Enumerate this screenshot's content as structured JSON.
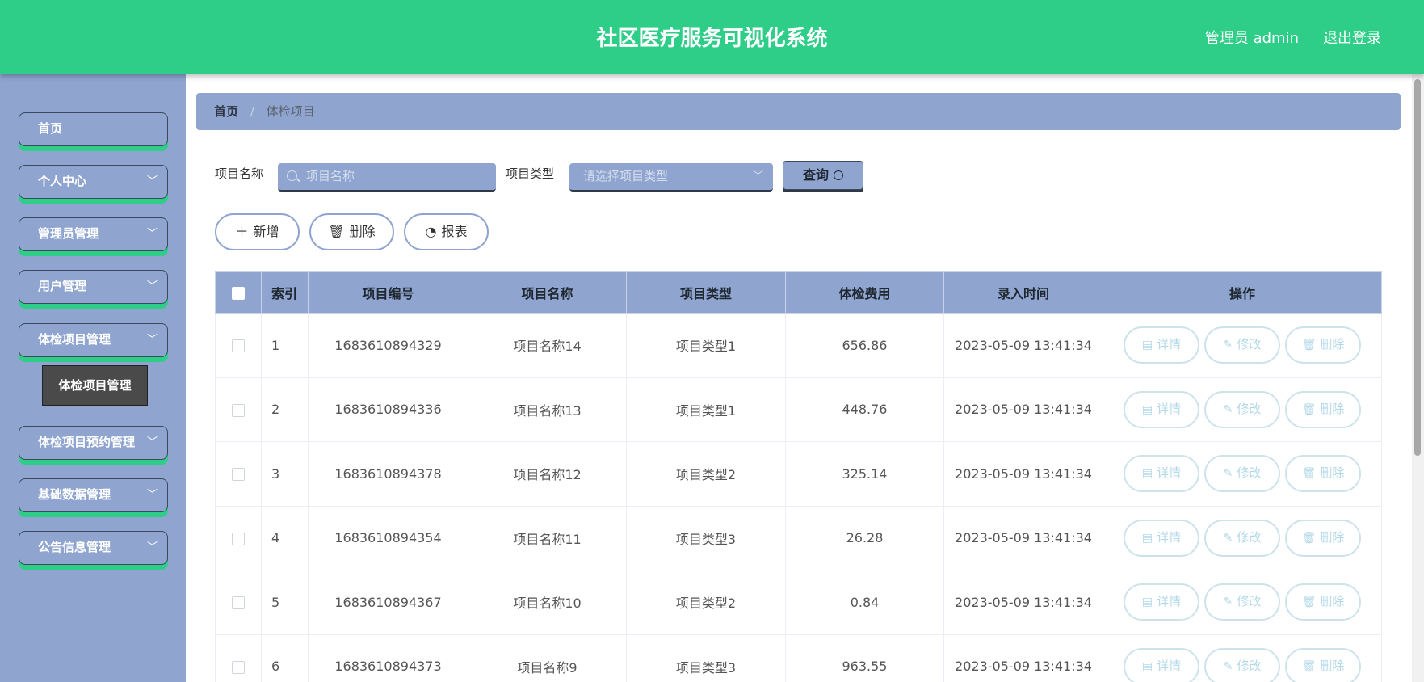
{
  "header": {
    "title": "社区医疗服务可视化系统",
    "admin_label": "管理员 admin",
    "logout_label": "退出登录"
  },
  "colors": {
    "header_bg": "#2ecd88",
    "sidebar_bg": "#8fa5d0",
    "accent_shadow": "#2ecd88",
    "op_button_border": "#cde3ec"
  },
  "sidebar": {
    "items": [
      {
        "label": "首页",
        "has_chevron": false
      },
      {
        "label": "个人中心",
        "has_chevron": true
      },
      {
        "label": "管理员管理",
        "has_chevron": true
      },
      {
        "label": "用户管理",
        "has_chevron": true
      },
      {
        "label": "体检项目管理",
        "has_chevron": true,
        "expanded": true
      },
      {
        "label": "体检项目预约管理",
        "has_chevron": true
      },
      {
        "label": "基础数据管理",
        "has_chevron": true
      },
      {
        "label": "公告信息管理",
        "has_chevron": true
      }
    ],
    "submenu": {
      "label": "体检项目管理"
    }
  },
  "breadcrumb": {
    "home": "首页",
    "separator": "/",
    "current": "体检项目"
  },
  "search": {
    "name_label": "项目名称",
    "name_placeholder": "项目名称",
    "type_label": "项目类型",
    "type_placeholder": "请选择项目类型",
    "query_label": "查询"
  },
  "actions": {
    "add_label": "新增",
    "delete_label": "删除",
    "report_label": "报表"
  },
  "table": {
    "columns": [
      "索引",
      "项目编号",
      "项目名称",
      "项目类型",
      "体检费用",
      "录入时间",
      "操作"
    ],
    "rows": [
      {
        "index": "1",
        "code": "1683610894329",
        "name": "项目名称14",
        "type": "项目类型1",
        "fee": "656.86",
        "time": "2023-05-09 13:41:34"
      },
      {
        "index": "2",
        "code": "1683610894336",
        "name": "项目名称13",
        "type": "项目类型1",
        "fee": "448.76",
        "time": "2023-05-09 13:41:34"
      },
      {
        "index": "3",
        "code": "1683610894378",
        "name": "项目名称12",
        "type": "项目类型2",
        "fee": "325.14",
        "time": "2023-05-09 13:41:34"
      },
      {
        "index": "4",
        "code": "1683610894354",
        "name": "项目名称11",
        "type": "项目类型3",
        "fee": "26.28",
        "time": "2023-05-09 13:41:34"
      },
      {
        "index": "5",
        "code": "1683610894367",
        "name": "项目名称10",
        "type": "项目类型2",
        "fee": "0.84",
        "time": "2023-05-09 13:41:34"
      },
      {
        "index": "6",
        "code": "1683610894373",
        "name": "项目名称9",
        "type": "项目类型3",
        "fee": "963.55",
        "time": "2023-05-09 13:41:34"
      }
    ],
    "row_ops": {
      "detail": "详情",
      "edit": "修改",
      "delete": "删除"
    }
  }
}
